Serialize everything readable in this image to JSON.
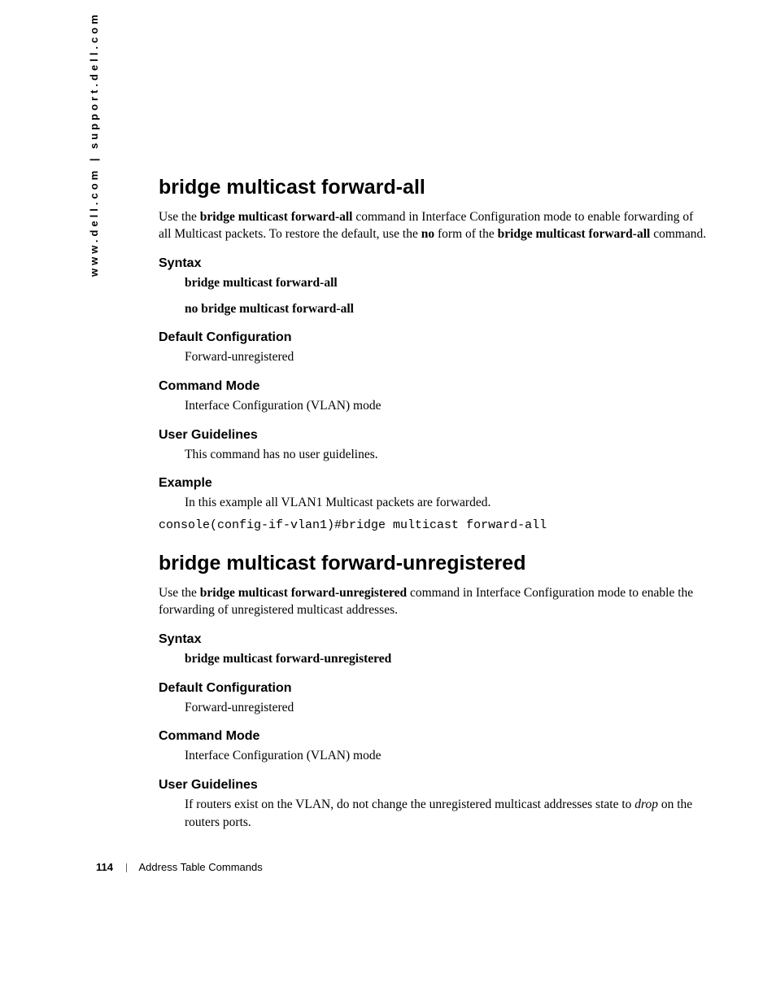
{
  "side_url": "www.dell.com | support.dell.com",
  "footer": {
    "page_number": "114",
    "section": "Address Table Commands"
  },
  "section1": {
    "title": "bridge multicast forward-all",
    "intro_pre": "Use the ",
    "intro_cmd": "bridge multicast forward-all",
    "intro_mid": " command in Interface Configuration mode to enable forwarding of all Multicast packets. To restore the default, use the ",
    "intro_no": "no",
    "intro_mid2": " form of the ",
    "intro_cmd2": "bridge multicast forward-all",
    "intro_post": " command.",
    "syntax_label": "Syntax",
    "syntax_line1": "bridge multicast forward-all",
    "syntax_line2": "no bridge multicast forward-all",
    "default_label": "Default Configuration",
    "default_text": "Forward-unregistered",
    "mode_label": "Command Mode",
    "mode_text": "Interface Configuration (VLAN) mode",
    "guidelines_label": "User Guidelines",
    "guidelines_text": "This command has no user guidelines.",
    "example_label": "Example",
    "example_text": "In this example all VLAN1 Multicast packets are forwarded.",
    "console": "console(config-if-vlan1)#bridge multicast forward-all"
  },
  "section2": {
    "title": "bridge multicast forward-unregistered",
    "intro_pre": "Use the ",
    "intro_cmd": "bridge multicast forward-unregistered",
    "intro_post": " command in Interface Configuration mode to enable the forwarding of unregistered multicast addresses.",
    "syntax_label": "Syntax",
    "syntax_line1": "bridge multicast forward-unregistered",
    "default_label": "Default Configuration",
    "default_text": "Forward-unregistered",
    "mode_label": "Command Mode",
    "mode_text": "Interface Configuration (VLAN) mode",
    "guidelines_label": "User Guidelines",
    "guidelines_pre": "If routers exist on the VLAN, do not change the unregistered multicast addresses state to ",
    "guidelines_italic": "drop",
    "guidelines_post": " on the routers ports."
  }
}
